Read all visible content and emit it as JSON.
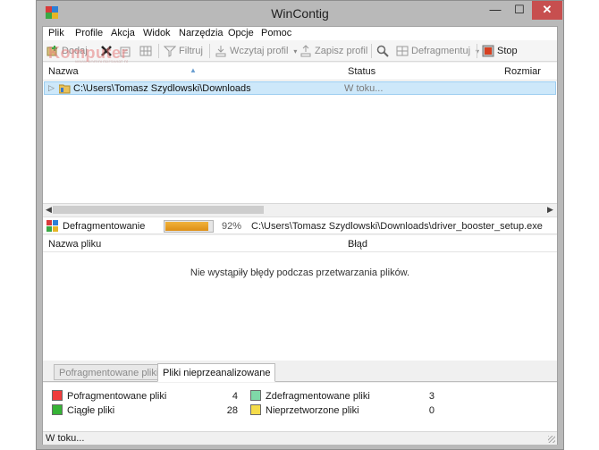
{
  "window": {
    "title": "WinContig",
    "minimize_glyph": "—",
    "maximize_glyph": "☐",
    "close_glyph": "✕",
    "app_icon_colors": [
      "#d83b3b",
      "#2d7fd6",
      "#3aa845",
      "#e6b626"
    ]
  },
  "menu": [
    "Plik",
    "Profile",
    "Akcja",
    "Widok",
    "Narzędzia",
    "Opcje",
    "Pomoc"
  ],
  "toolbar": {
    "add_label": "Dodaj",
    "filter_label": "Filtruj",
    "load_profile_label": "Wczytaj profil",
    "save_profile_label": "Zapisz profil",
    "defragment_label": "Defragmentuj",
    "stop_label": "Stop",
    "icons": [
      "add-icon",
      "remove-icon",
      "clear-icon",
      "grid-icon",
      "filter-icon",
      "load-profile-icon",
      "save-profile-icon",
      "analyze-icon",
      "defragment-icon",
      "stop-icon"
    ]
  },
  "watermark": {
    "text": "Komputer",
    "subtext": "www.komputerswiat.pl"
  },
  "targets": {
    "columns": [
      "Nazwa",
      "Status",
      "Rozmiar"
    ],
    "rows": [
      {
        "name": "C:\\Users\\Tomasz Szydlowski\\Downloads",
        "status": "W toku..."
      }
    ]
  },
  "progress": {
    "label": "Defragmentowanie",
    "percent": 92,
    "percent_text": "92%",
    "file": "C:\\Users\\Tomasz Szydlowski\\Downloads\\driver_booster_setup.exe"
  },
  "errors": {
    "columns": [
      "Nazwa pliku",
      "Błąd"
    ],
    "empty_message": "Nie wystąpiły błędy podczas przetwarzania plików."
  },
  "tabs": [
    "Pofragmentowane pliki",
    "Pliki nieprzeanalizowane"
  ],
  "active_tab": 1,
  "legend": [
    {
      "label": "Pofragmentowane pliki",
      "value": "4",
      "color": "#f03c3c"
    },
    {
      "label": "Zdefragmentowane pliki",
      "value": "3",
      "color": "#7fd8a8"
    },
    {
      "label": "Ciągłe pliki",
      "value": "28",
      "color": "#36b336"
    },
    {
      "label": "Nieprzetworzone pliki",
      "value": "0",
      "color": "#f5dc4a"
    }
  ],
  "status_bar": "W toku..."
}
